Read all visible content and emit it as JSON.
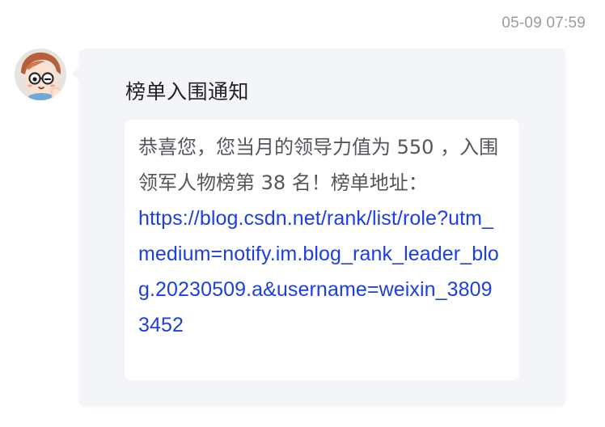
{
  "message": {
    "timestamp": "05-09 07:59",
    "title": "榜单入围通知",
    "body_text": "恭喜您，您当月的领导力值为 550 ，入围领军人物榜第 38 名！榜单地址：",
    "link_text": "https://blog.csdn.net/rank/list/role?utm_medium=notify.im.blog_rank_leader_blog.20230509.a&username=weixin_38093452"
  },
  "avatar": {
    "icon": "cartoon-avatar-icon"
  },
  "colors": {
    "link": "#1d3fe0",
    "bubble_bg": "#f4f5f8",
    "card_bg": "#ffffff",
    "timestamp": "#9a9ba3"
  }
}
